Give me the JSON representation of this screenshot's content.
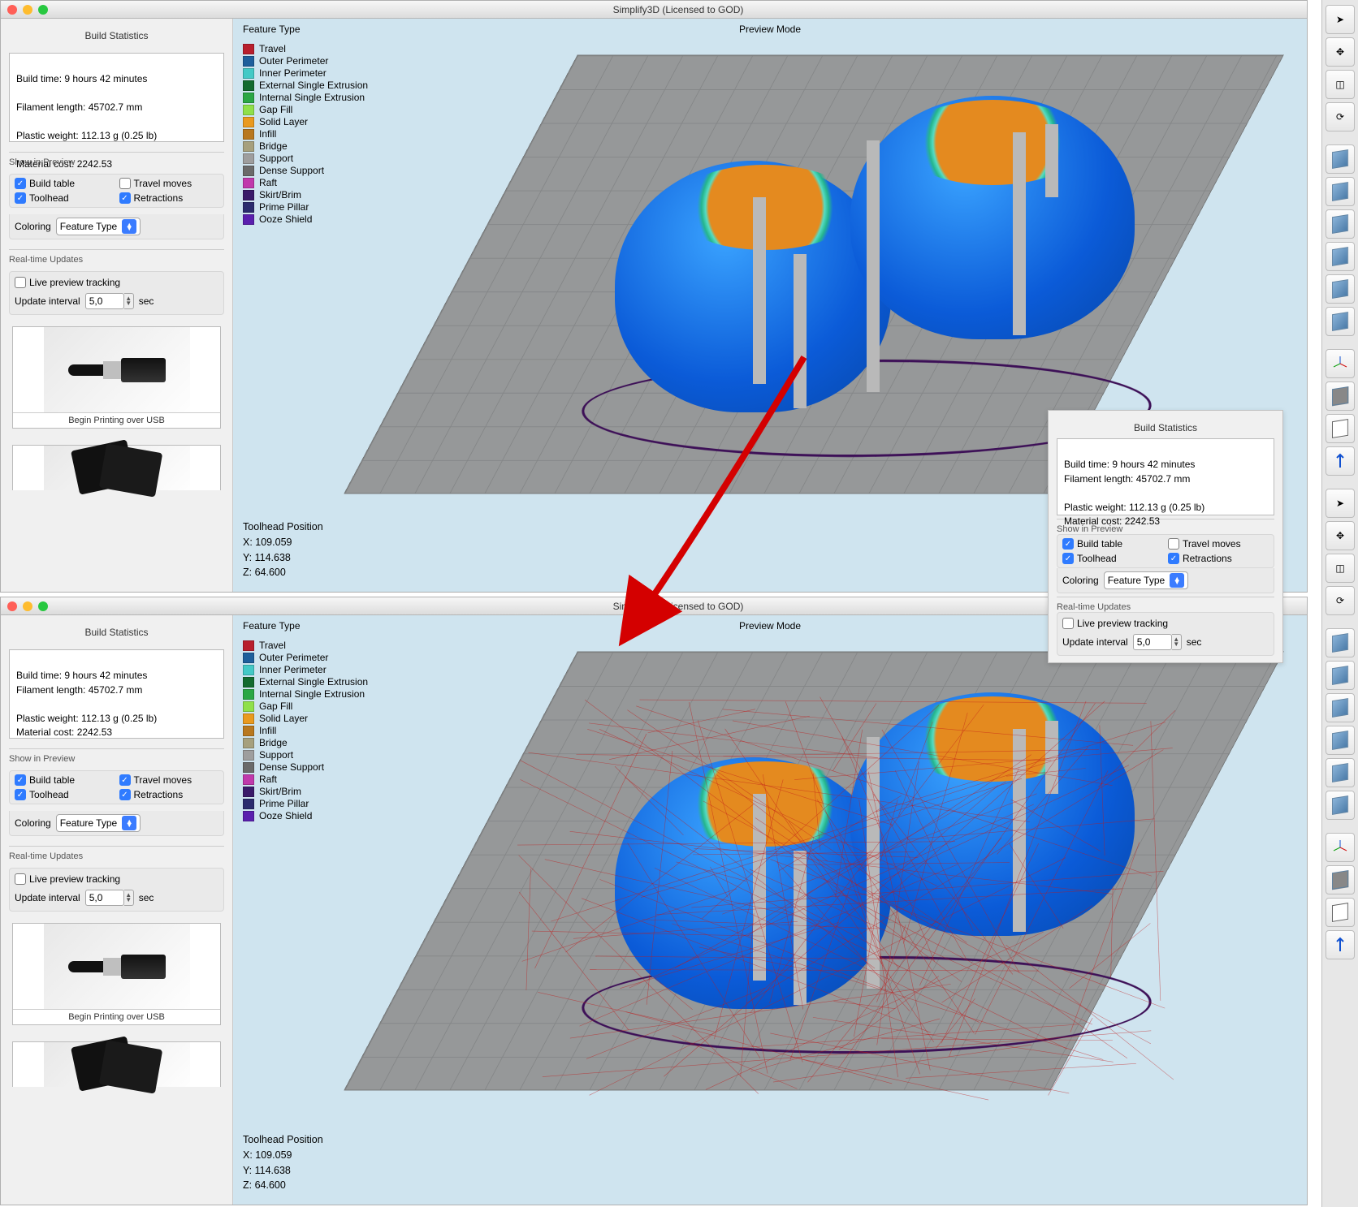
{
  "app": {
    "title": "Simplify3D (Licensed to GOD)"
  },
  "stats": {
    "heading": "Build Statistics",
    "build_time": "Build time: 9 hours 42 minutes",
    "filament": "Filament length: 45702.7 mm",
    "weight": "Plastic weight: 112.13 g (0.25 lb)",
    "cost": "Material cost: 2242.53"
  },
  "preview": {
    "section_label": "Show in Preview",
    "build_table": "Build table",
    "travel_moves": "Travel moves",
    "toolhead": "Toolhead",
    "retractions": "Retractions",
    "coloring_label": "Coloring",
    "coloring_value": "Feature Type"
  },
  "realtime": {
    "section_label": "Real-time Updates",
    "live_label": "Live preview tracking",
    "interval_label": "Update interval",
    "interval_value": "5,0",
    "sec_label": "sec"
  },
  "media": {
    "usb_caption": "Begin Printing over USB"
  },
  "viewport": {
    "feature_type_label": "Feature Type",
    "preview_mode_label": "Preview Mode",
    "toolhead_pos_label": "Toolhead Position",
    "x": "X: 109.059",
    "y": "Y: 114.638",
    "z": "Z: 64.600"
  },
  "legend": [
    {
      "color": "#b81f2d",
      "label": "Travel"
    },
    {
      "color": "#1e5f9c",
      "label": "Outer Perimeter"
    },
    {
      "color": "#43c9c6",
      "label": "Inner Perimeter"
    },
    {
      "color": "#126b2f",
      "label": "External Single Extrusion"
    },
    {
      "color": "#2aa745",
      "label": "Internal Single Extrusion"
    },
    {
      "color": "#8fe04a",
      "label": "Gap Fill"
    },
    {
      "color": "#e99a1f",
      "label": "Solid Layer"
    },
    {
      "color": "#b8781f",
      "label": "Infill"
    },
    {
      "color": "#a6a07d",
      "label": "Bridge"
    },
    {
      "color": "#9e9e9e",
      "label": "Support"
    },
    {
      "color": "#6a6a6a",
      "label": "Dense Support"
    },
    {
      "color": "#c039ac",
      "label": "Raft"
    },
    {
      "color": "#3a1a6a",
      "label": "Skirt/Brim"
    },
    {
      "color": "#2b2b6e",
      "label": "Prime Pillar"
    },
    {
      "color": "#5a1fae",
      "label": "Ooze Shield"
    }
  ],
  "toolbar": {
    "cursor": "cursor",
    "pan": "pan",
    "crop": "crop",
    "refresh": "refresh",
    "view_iso": "iso-view",
    "view_front": "front-view",
    "view_top": "top-view",
    "view_right": "right-view",
    "view_left": "left-view",
    "view_back": "back-view",
    "axes": "axes",
    "shaded": "shaded",
    "wire": "wireframe",
    "zoom": "zoom-fit"
  },
  "top_checkboxes": {
    "build_table": true,
    "travel_moves": false,
    "toolhead": true,
    "retractions": true,
    "live": false
  },
  "float_checkboxes": {
    "build_table": true,
    "travel_moves": false,
    "toolhead": true,
    "retractions": true,
    "live": false
  },
  "bottom_checkboxes": {
    "build_table": true,
    "travel_moves": true,
    "toolhead": true,
    "retractions": true,
    "live": false
  }
}
